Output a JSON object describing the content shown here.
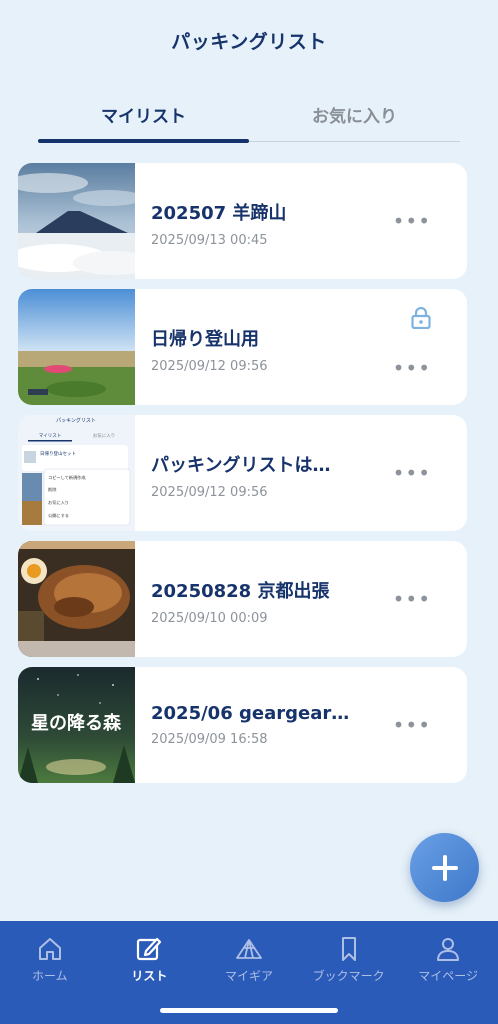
{
  "header": {
    "title": "パッキングリスト"
  },
  "tabs": [
    {
      "label": "マイリスト",
      "active": true
    },
    {
      "label": "お気に入り",
      "active": false
    }
  ],
  "lists": [
    {
      "title": "202507 羊蹄山",
      "date": "2025/09/13 00:45",
      "locked": false,
      "thumb": "mountain-icon"
    },
    {
      "title": "日帰り登山用",
      "date": "2025/09/12 09:56",
      "locked": true,
      "thumb": "field-icon"
    },
    {
      "title": "パッキングリストは…",
      "date": "2025/09/12 09:56",
      "locked": false,
      "thumb": "screenshot-icon"
    },
    {
      "title": "20250828 京都出張",
      "date": "2025/09/10 00:09",
      "locked": false,
      "thumb": "food-icon"
    },
    {
      "title": "2025/06 geargear…",
      "date": "2025/09/09 16:58",
      "locked": false,
      "thumb": "poster-icon"
    }
  ],
  "thumb_texts": {
    "screenshot": {
      "title": "パッキングリスト",
      "tab1": "マイリスト",
      "tab2": "お気に入り",
      "item": "日帰り登山セット",
      "menu": [
        "コピーして新規作成",
        "削除",
        "お気に入り",
        "公開にする"
      ]
    },
    "poster": "星の降る森"
  },
  "more_label": "•••",
  "fab": {
    "icon": "plus-icon"
  },
  "tabbar": [
    {
      "label": "ホーム",
      "icon": "home-icon",
      "active": false
    },
    {
      "label": "リスト",
      "icon": "edit-icon",
      "active": true
    },
    {
      "label": "マイギア",
      "icon": "tent-icon",
      "active": false
    },
    {
      "label": "ブックマーク",
      "icon": "bookmark-icon",
      "active": false
    },
    {
      "label": "マイページ",
      "icon": "person-icon",
      "active": false
    }
  ],
  "colors": {
    "accent": "#17336b",
    "tabbar": "#2b5bb8",
    "background": "#e6f1f9"
  }
}
